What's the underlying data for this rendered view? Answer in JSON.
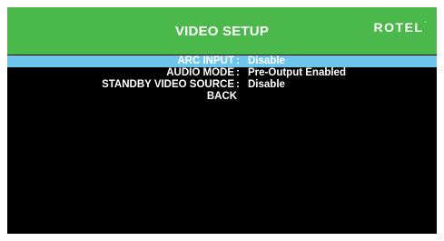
{
  "header": {
    "title": "VIDEO SETUP",
    "brand": "ROTEL",
    "brand_mark": "·"
  },
  "menu": {
    "items": [
      {
        "label": "ARC INPUT",
        "separator": ":",
        "value": "Disable",
        "selected": true
      },
      {
        "label": "AUDIO MODE",
        "separator": ":",
        "value": "Pre-Output Enabled",
        "selected": false
      },
      {
        "label": "STANDBY VIDEO SOURCE",
        "separator": ":",
        "value": "Disable",
        "selected": false
      }
    ],
    "back_label": "BACK"
  },
  "colors": {
    "header_bg": "#4ab84a",
    "selection_bg": "#6ec6ec",
    "screen_bg": "#000000",
    "text": "#ffffff"
  }
}
